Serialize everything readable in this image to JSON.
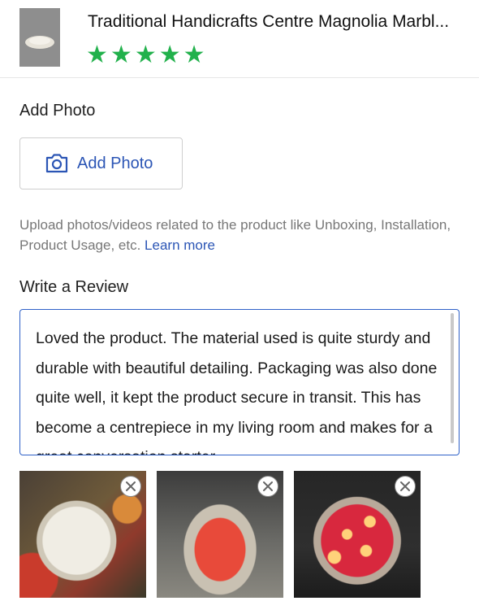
{
  "product": {
    "title": "Traditional Handicrafts Centre Magnolia Marbl...",
    "rating": 5,
    "stars": [
      "★",
      "★",
      "★",
      "★",
      "★"
    ],
    "star_color": "#22b14c"
  },
  "add_photo": {
    "section_label": "Add Photo",
    "button_label": "Add Photo",
    "help_text": "Upload photos/videos related to the product like Unboxing, Installation, Product Usage, etc.",
    "learn_more": "Learn more"
  },
  "review": {
    "section_label": "Write a Review",
    "text": "Loved the product. The material used is quite sturdy and durable with beautiful detailing. Packaging was also done quite well, it kept the product secure in transit. This has become a centrepiece in my living room and makes for a great conversation starter."
  },
  "photos": [
    {
      "icon": "remove-icon"
    },
    {
      "icon": "remove-icon"
    },
    {
      "icon": "remove-icon"
    }
  ],
  "colors": {
    "accent": "#2b55b5",
    "focus_border": "#2f62c8"
  }
}
